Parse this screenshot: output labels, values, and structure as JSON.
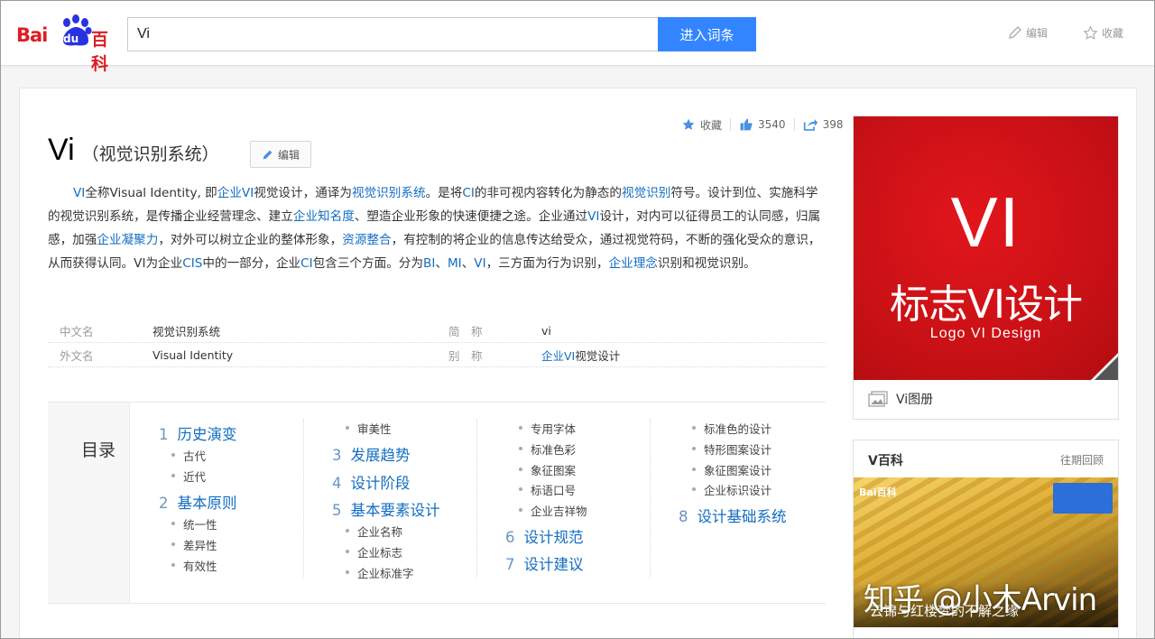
{
  "header": {
    "logo_bai": "Bai",
    "logo_du": "du",
    "logo_baike": "百科",
    "search_value": "Vi",
    "search_button": "进入词条",
    "edit_label": "编辑",
    "fav_label": "收藏"
  },
  "stats": {
    "fav_label": "收藏",
    "likes": "3540",
    "shares": "398"
  },
  "entry": {
    "title": "Vi",
    "subtitle": "（视觉识别系统）",
    "edit_label": "编辑",
    "intro": [
      {
        "t": "VI",
        "link": true
      },
      {
        "t": "全称Visual Identity, 即"
      },
      {
        "t": "企业VI",
        "link": true
      },
      {
        "t": "视觉设计，通译为"
      },
      {
        "t": "视觉识别系统",
        "link": true
      },
      {
        "t": "。是将"
      },
      {
        "t": "CI",
        "link": true
      },
      {
        "t": "的非可视内容转化为静态的"
      },
      {
        "t": "视觉识别",
        "link": true
      },
      {
        "t": "符号。设计到位、实施科学的视觉识别系统，是传播企业经营理念、建立"
      },
      {
        "t": "企业知名度",
        "link": true
      },
      {
        "t": "、塑造企业形象的快速便捷之途。企业通过"
      },
      {
        "t": "VI",
        "link": true
      },
      {
        "t": "设计，对内可以征得员工的认同感，归属感，加强"
      },
      {
        "t": "企业凝聚力",
        "link": true
      },
      {
        "t": "，对外可以树立企业的整体形象，"
      },
      {
        "t": "资源整合",
        "link": true
      },
      {
        "t": "，有控制的将企业的信息传达给受众，通过视觉符码，不断的强化受众的意识，从而获得认同。VI为企业"
      },
      {
        "t": "CIS",
        "link": true
      },
      {
        "t": "中的一部分，企业"
      },
      {
        "t": "CI",
        "link": true
      },
      {
        "t": "包含三个方面。分为"
      },
      {
        "t": "BI",
        "link": true
      },
      {
        "t": "、"
      },
      {
        "t": "MI",
        "link": true
      },
      {
        "t": "、"
      },
      {
        "t": "VI",
        "link": true
      },
      {
        "t": "，三方面为行为识别，"
      },
      {
        "t": "企业理念",
        "link": true
      },
      {
        "t": "识别和视觉识别。"
      }
    ]
  },
  "basic_info": {
    "row1": {
      "k1": "中文名",
      "v1": "视觉识别系统",
      "k2": "简　称",
      "v2": "vi"
    },
    "row2": {
      "k1": "外文名",
      "v1": "Visual Identity",
      "k2": "别　称",
      "v2a": "企业VI",
      "v2b": "视觉设计"
    }
  },
  "catalog": {
    "heading": "目录",
    "c1": {
      "s1": {
        "n": "1",
        "t": "历史演变"
      },
      "s1a": "古代",
      "s1b": "近代",
      "s2": {
        "n": "2",
        "t": "基本原则"
      },
      "s2a": "统一性",
      "s2b": "差异性",
      "s2c": "有效性"
    },
    "c2": {
      "s2d": "审美性",
      "s3": {
        "n": "3",
        "t": "发展趋势"
      },
      "s4": {
        "n": "4",
        "t": "设计阶段"
      },
      "s5": {
        "n": "5",
        "t": "基本要素设计"
      },
      "s5a": "企业名称",
      "s5b": "企业标志",
      "s5c": "企业标准字"
    },
    "c3": {
      "s5d": "专用字体",
      "s5e": "标准色彩",
      "s5f": "象征图案",
      "s5g": "标语口号",
      "s5h": "企业吉祥物",
      "s6": {
        "n": "6",
        "t": "设计规范"
      },
      "s7": {
        "n": "7",
        "t": "设计建议"
      }
    },
    "c4": {
      "s7a": "标准色的设计",
      "s7b": "特形图案设计",
      "s7c": "象征图案设计",
      "s7d": "企业标识设计",
      "s8": {
        "n": "8",
        "t": "设计基础系统"
      }
    }
  },
  "album": {
    "big": "VI",
    "mid": "标志VI设计",
    "small": "Logo VI Design",
    "caption": "Vi图册"
  },
  "vbaike": {
    "title": "V百科",
    "more": "往期回顾",
    "img_logo": "Bai百科",
    "img_caption": "云锦与红楼梦的不解之缘"
  },
  "watermark": "知乎 @小木Arvin",
  "colors": {
    "accent": "#3385ff",
    "link": "#136ec2",
    "brand": "#de1d24"
  }
}
